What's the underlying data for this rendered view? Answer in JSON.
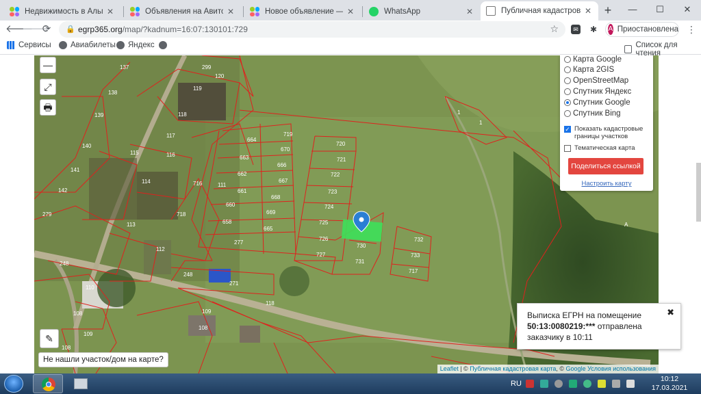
{
  "browser": {
    "tabs": [
      {
        "title": "Недвижимость в Альметь",
        "favicon": "avito-icon"
      },
      {
        "title": "Объявления на Авито Pro",
        "favicon": "avito-icon"
      },
      {
        "title": "Новое объявление — Объ",
        "favicon": "avito-icon"
      },
      {
        "title": "WhatsApp",
        "favicon": "whatsapp-icon"
      },
      {
        "title": "Публичная кадастровая ка",
        "favicon": "page-icon",
        "active": true
      }
    ],
    "new_tab": "+",
    "window_controls": {
      "minimize": "—",
      "maximize": "☐",
      "close": "✕"
    },
    "url_host": "egrp365.org",
    "url_path": "/map/?kadnum=16:07:130101:729",
    "profile_initial": "А",
    "profile_label": "Приостановлена",
    "bookmarks": [
      {
        "label": "Сервисы",
        "icon": "apps-grid-icon"
      },
      {
        "label": "Авиабилеты",
        "icon": "globe-icon"
      },
      {
        "label": "Яндекс",
        "icon": "globe-icon"
      },
      {
        "label": "",
        "icon": "globe-icon"
      }
    ],
    "reading_list": "Список для чтения"
  },
  "map": {
    "controls": {
      "zoom_out": "—",
      "fullscreen": "⤢",
      "print": "🖶",
      "draw": "✎"
    },
    "layers": [
      {
        "label": "Карта Google",
        "selected": false
      },
      {
        "label": "Карта 2GIS",
        "selected": false
      },
      {
        "label": "OpenStreetMap",
        "selected": false
      },
      {
        "label": "Спутник Яндекс",
        "selected": false
      },
      {
        "label": "Спутник Google",
        "selected": true
      },
      {
        "label": "Спутник Bing",
        "selected": false
      }
    ],
    "show_borders": {
      "label_line1": "Показать кадастровые",
      "label_line2": "границы участков",
      "checked": true
    },
    "thematic": {
      "label": "Тематическая карта",
      "checked": false
    },
    "share_button": "Поделиться ссылкой",
    "configure_link": "Настроить карту",
    "not_found_button": "Не нашли участок/дом на карте?",
    "toast": {
      "line1": "Выписка ЕГРН на помещение",
      "number": "50:13:0080219:***",
      "line2_rest": " отправлена",
      "line3": "заказчику в 10:11",
      "close": "✖"
    },
    "attribution": {
      "leaflet": "Leaflet",
      "sep1": " | © ",
      "pkk": "Публичная кадастровая карта",
      "sep2": ", © ",
      "google": "Google",
      "terms": "Условия использования"
    },
    "parcel_labels": [
      "137",
      "299",
      "120",
      "138",
      "119",
      "139",
      "118",
      "117",
      "140",
      "116",
      "115",
      "141",
      "114",
      "142",
      "113",
      "279",
      "112",
      "248",
      "110",
      "109",
      "108",
      "108",
      "109",
      "108",
      "111",
      "271",
      "118",
      "248",
      "716",
      "718",
      "719",
      "720",
      "664",
      "670",
      "721",
      "663",
      "666",
      "722",
      "662",
      "667",
      "723",
      "661",
      "668",
      "724",
      "660",
      "669",
      "725",
      "658",
      "665",
      "726",
      "730",
      "732",
      "277",
      "727",
      "731",
      "733",
      "717",
      "1",
      "1",
      "A"
    ],
    "highlight_color": "#3de05a",
    "border_color": "#e0211d"
  },
  "taskbar": {
    "lang": "RU",
    "time": "10:12",
    "date": "17.03.2021"
  }
}
